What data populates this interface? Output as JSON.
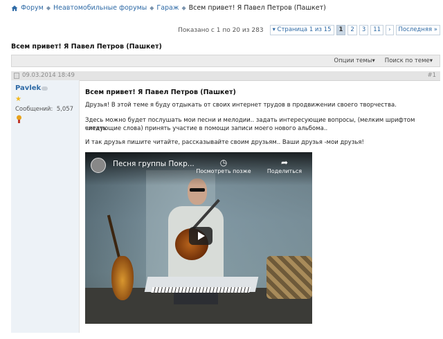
{
  "breadcrumb": {
    "items": [
      "Форум",
      "Неавтомобильные форумы",
      "Гараж"
    ],
    "current": "Всем привет! Я Павел Петров (Пашкет)"
  },
  "pagination": {
    "count_text": "Показано с 1 по 20 из 283",
    "page_of": "Страница 1 из 15",
    "pages": [
      "1",
      "2",
      "3",
      "11"
    ],
    "next": "›",
    "last": "Последняя"
  },
  "thread": {
    "title": "Всем привет! Я Павел Петров (Пашкет)",
    "options": "Опции темы",
    "search": "Поиск по теме"
  },
  "post": {
    "date": "09.03.2014 18:49",
    "number": "#1",
    "author": "Pavlek",
    "messages_label": "Сообщений:",
    "messages_count": "5,057",
    "title": "Всем привет! Я Павел Петров (Пашкет)",
    "lines": [
      "Друзья! В этой теме я буду отдыкать от своих интернет трудов в продвижении своего творчества.",
      "Здесь можно будет послушать мои песни и мелодии.. задать интересующие вопросы, (мелким шрифтом читать",
      "следующие слова) принять участие в помощи записи моего нового альбома..",
      "И так друзья пишите читайте, рассказывайте своим друзьям.. Ваши друзья -мои друзья!"
    ],
    "video": {
      "title": "Песня группы Покр...",
      "watch_later": "Посмотреть позже",
      "share": "Поделиться"
    }
  },
  "colors": {
    "link": "#2e6aa6",
    "sidebar_bg": "#edf2f7",
    "star": "#f3b81a"
  }
}
